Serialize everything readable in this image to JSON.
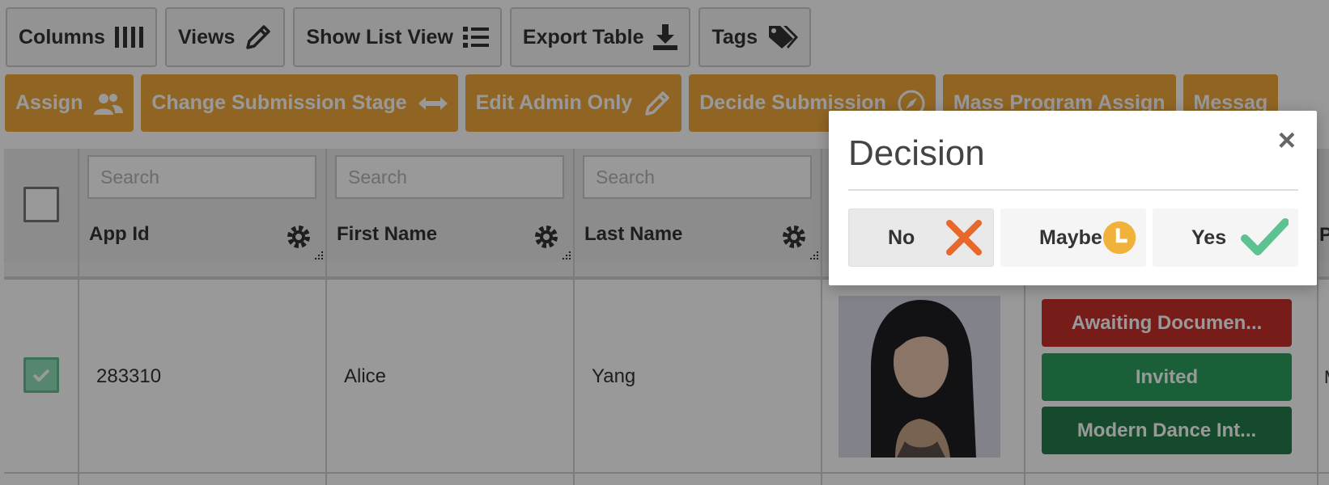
{
  "toolbar": {
    "columns_label": "Columns",
    "views_label": "Views",
    "list_view_label": "Show List View",
    "export_label": "Export Table",
    "tags_label": "Tags"
  },
  "actions": {
    "assign_label": "Assign",
    "change_stage_label": "Change Submission Stage",
    "edit_admin_label": "Edit Admin Only",
    "decide_label": "Decide Submission",
    "mass_assign_label": "Mass Program Assign",
    "message_label": "Messag"
  },
  "table": {
    "search_placeholder": "Search",
    "columns": [
      {
        "label": "App Id"
      },
      {
        "label": "First Name"
      },
      {
        "label": "Last Name"
      }
    ],
    "row": {
      "app_id": "283310",
      "first_name": "Alice",
      "last_name": "Yang",
      "tags": [
        {
          "label": "Awaiting Documen...",
          "color": "#c9302c"
        },
        {
          "label": "Invited",
          "color": "#2e9e5e"
        },
        {
          "label": "Modern Dance Int...",
          "color": "#267c4c"
        }
      ],
      "edge_header": "P",
      "edge_cell": "M"
    }
  },
  "modal": {
    "title": "Decision",
    "close_glyph": "×",
    "options": [
      {
        "label": "No",
        "icon": "x-icon",
        "color": "#e8672a"
      },
      {
        "label": "Maybe",
        "icon": "clock-icon",
        "color": "#f0b23a"
      },
      {
        "label": "Yes",
        "icon": "check-icon",
        "color": "#5cc28f"
      }
    ]
  },
  "colors": {
    "action_button": "#f0a83c",
    "overlay": "rgba(0,0,0,0.40)"
  }
}
